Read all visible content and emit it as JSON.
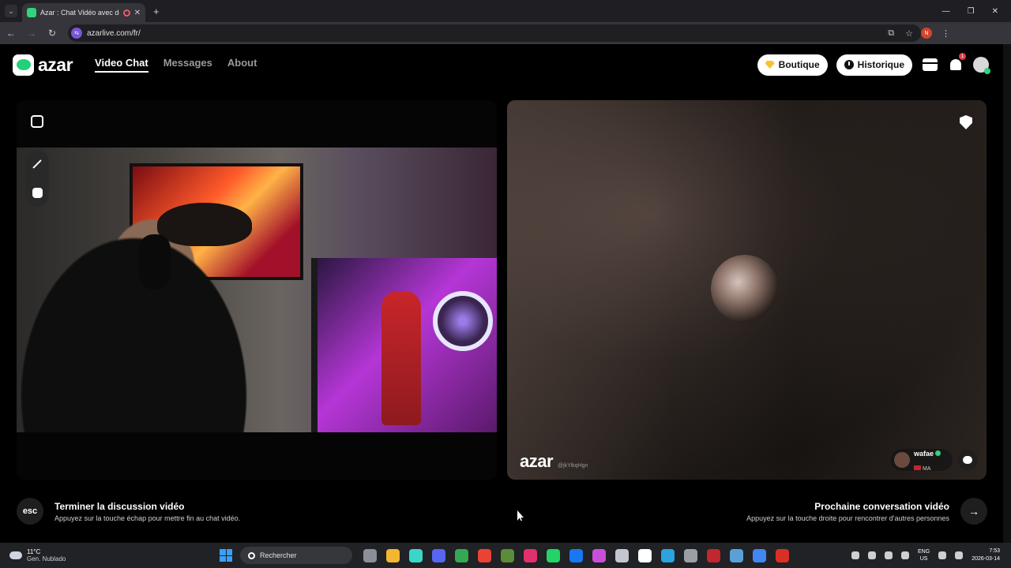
{
  "browser": {
    "tab_title": "Azar : Chat Vidéo avec de",
    "tab_close": "✕",
    "new_tab": "+",
    "url": "azarlive.com/fr/",
    "profile_initial": "N",
    "window_controls": [
      "—",
      "❐",
      "✕"
    ]
  },
  "header": {
    "logo": "azar",
    "nav": [
      {
        "label": "Video Chat",
        "active": true
      },
      {
        "label": "Messages",
        "active": false
      },
      {
        "label": "About",
        "active": false
      }
    ],
    "boutique_label": "Boutique",
    "historique_label": "Historique",
    "notification_count": "1"
  },
  "peer": {
    "watermark_logo": "azar",
    "watermark_id": "@jkYikqHgn",
    "name": "wafae",
    "country": "MA"
  },
  "actions": {
    "end_key": "esc",
    "end_title": "Terminer la discussion vidéo",
    "end_sub": "Appuyez sur la touche échap pour mettre fin au chat vidéo.",
    "next_title": "Prochaine conversation vidéo",
    "next_sub": "Appuyez sur la touche droite pour rencontrer d'autres personnes",
    "next_key": "→"
  },
  "taskbar": {
    "temperature": "11°C",
    "weather": "Gen. Nublado",
    "search_placeholder": "Rechercher",
    "lang_top": "ENG",
    "lang_bottom": "US",
    "time": "7:53",
    "date": "2026-03-14",
    "app_colors": [
      "#8a8f98",
      "#f2b632",
      "#3ad7c8",
      "#5865f2",
      "#34a853",
      "#ea4335",
      "#5b8c3a",
      "#e1306c",
      "#25d366",
      "#1877f2",
      "#c94fd8",
      "#c2c7cf",
      "#ffffff",
      "#2aa3e0",
      "#9aa0a6",
      "#c1272d",
      "#5aa0d8",
      "#4285f4",
      "#d93025"
    ]
  },
  "colors": {
    "accent_green": "#22d07a",
    "badge_red": "#e23a4a",
    "gem_gold": "#f4c430"
  }
}
